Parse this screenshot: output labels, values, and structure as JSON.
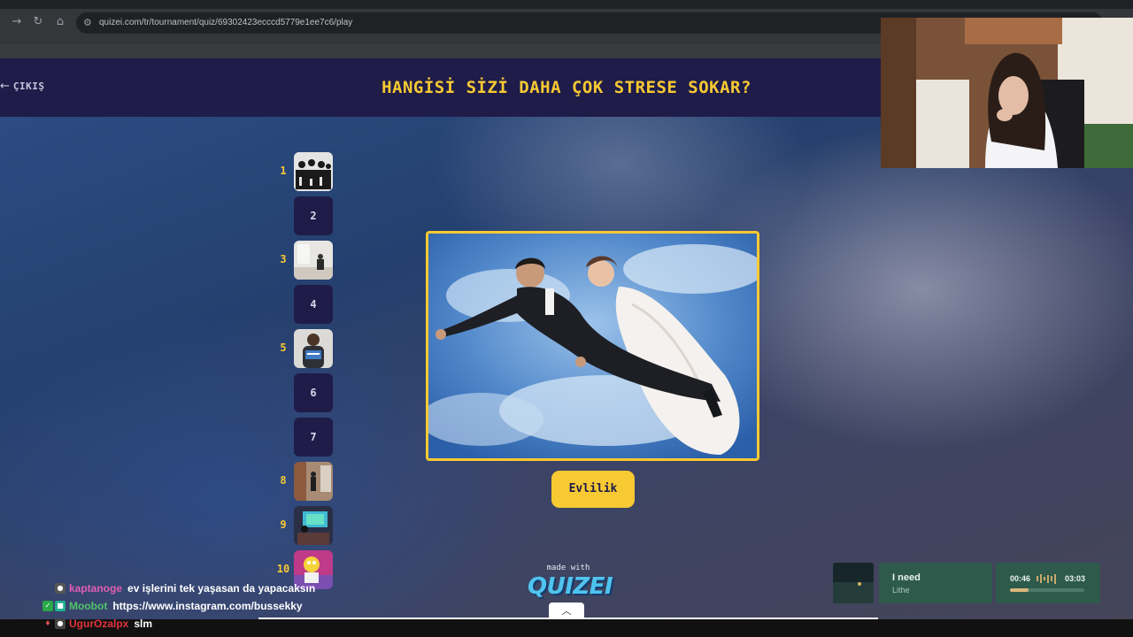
{
  "browser": {
    "back_icon": "arrow-left-icon",
    "forward_icon": "arrow-right-icon",
    "reload_icon": "reload-icon",
    "home_icon": "home-icon",
    "url": "quizei.com/tr/tournament/quiz/69302423ecccd5779e1ee7c6/play"
  },
  "header": {
    "back_label": "ÇIKIŞ",
    "title": "HANGİSİ SİZİ DAHA ÇOK STRESE SOKAR?"
  },
  "bracket": [
    {
      "number": "1",
      "thumb_label": ""
    },
    {
      "number": "",
      "thumb_label": "2"
    },
    {
      "number": "3",
      "thumb_label": ""
    },
    {
      "number": "",
      "thumb_label": "4"
    },
    {
      "number": "5",
      "thumb_label": ""
    },
    {
      "number": "",
      "thumb_label": "6"
    },
    {
      "number": "",
      "thumb_label": "7"
    },
    {
      "number": "8",
      "thumb_label": ""
    },
    {
      "number": "9",
      "thumb_label": ""
    },
    {
      "number": "10",
      "thumb_label": ""
    }
  ],
  "current_choice": {
    "label": "Evlilik"
  },
  "footer": {
    "made_with": "made with",
    "brand": "QUIZEI"
  },
  "chat": [
    {
      "user": "kaptanoge",
      "message": "ev işlerini tek yaşasan da yapacaksın",
      "user_color": "#e05fb3"
    },
    {
      "user": "Moobot",
      "message": "https://www.instagram.com/bussekky",
      "user_color": "#4fc46a"
    },
    {
      "user": "UgurOzalpx",
      "message": "slm",
      "user_color": "#e0323a"
    }
  ],
  "music": {
    "title": "I need",
    "artist": "Lithe",
    "elapsed": "00:46",
    "duration": "03:03",
    "progress": 0.25
  },
  "colors": {
    "accent": "#f7c933",
    "header_bg": "#1f1c49",
    "brand": "#4fc4ef"
  }
}
